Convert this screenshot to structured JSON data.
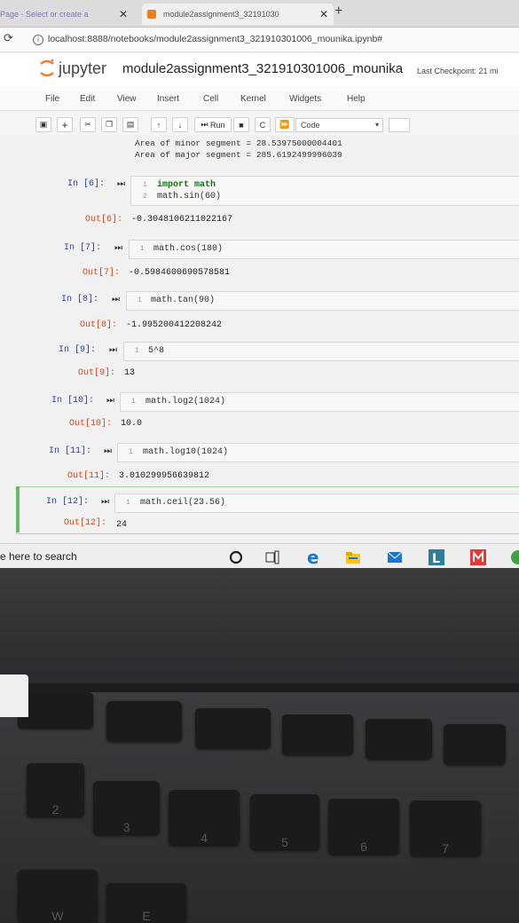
{
  "browser": {
    "tabs": [
      {
        "label": "Page - Select or create a"
      },
      {
        "label": "module2assignment3_32191030"
      }
    ],
    "url": "localhost:8888/notebooks/module2assignment3_321910301006_mounika.ipynb#"
  },
  "jupyter": {
    "brand": "jupyter",
    "notebook_name": "module2assignment3_321910301006_mounika",
    "checkpoint": "Last Checkpoint: 21 mi"
  },
  "menu": [
    "File",
    "Edit",
    "View",
    "Insert",
    "Cell",
    "Kernel",
    "Widgets",
    "Help"
  ],
  "toolbar": {
    "run_label": "Run",
    "cell_type": "Code"
  },
  "prev_output": {
    "lines": [
      "Area of minor segment = 28.53975000004401",
      "Area of major segment = 285.6192499996039"
    ]
  },
  "cells": [
    {
      "in": "In [6]:",
      "lines": [
        [
          "1",
          "import math"
        ],
        [
          "2",
          "math.sin(60)"
        ]
      ],
      "out": "Out[6]:",
      "result": "-0.3048106211022167"
    },
    {
      "in": "In [7]:",
      "lines": [
        [
          "1",
          "math.cos(180)"
        ]
      ],
      "out": "Out[7]:",
      "result": "-0.5984600690578581"
    },
    {
      "in": "In [8]:",
      "lines": [
        [
          "1",
          "math.tan(90)"
        ]
      ],
      "out": "Out[8]:",
      "result": "-1.995200412208242"
    },
    {
      "in": "In [9]:",
      "lines": [
        [
          "1",
          "5^8"
        ]
      ],
      "out": "Out[9]:",
      "result": "13"
    },
    {
      "in": "In [10]:",
      "lines": [
        [
          "1",
          "math.log2(1024)"
        ]
      ],
      "out": "Out[10]:",
      "result": "10.0"
    },
    {
      "in": "In [11]:",
      "lines": [
        [
          "1",
          "math.log10(1024)"
        ]
      ],
      "out": "Out[11]:",
      "result": "3.010299956639812"
    },
    {
      "in": "In [12]:",
      "lines": [
        [
          "1",
          "math.ceil(23.56)"
        ]
      ],
      "out": "Out[12]:",
      "result": "24"
    }
  ],
  "taskbar": {
    "search_text": "e here to search",
    "icons": [
      "cortana-icon",
      "task-view-icon",
      "edge-icon",
      "file-explorer-icon",
      "mail-icon",
      "l-app-icon",
      "m-app-icon",
      "chrome-icon"
    ]
  },
  "keyboard": {
    "keys": [
      "2",
      "3",
      "4",
      "5",
      "6",
      "7",
      "W",
      "E"
    ]
  }
}
